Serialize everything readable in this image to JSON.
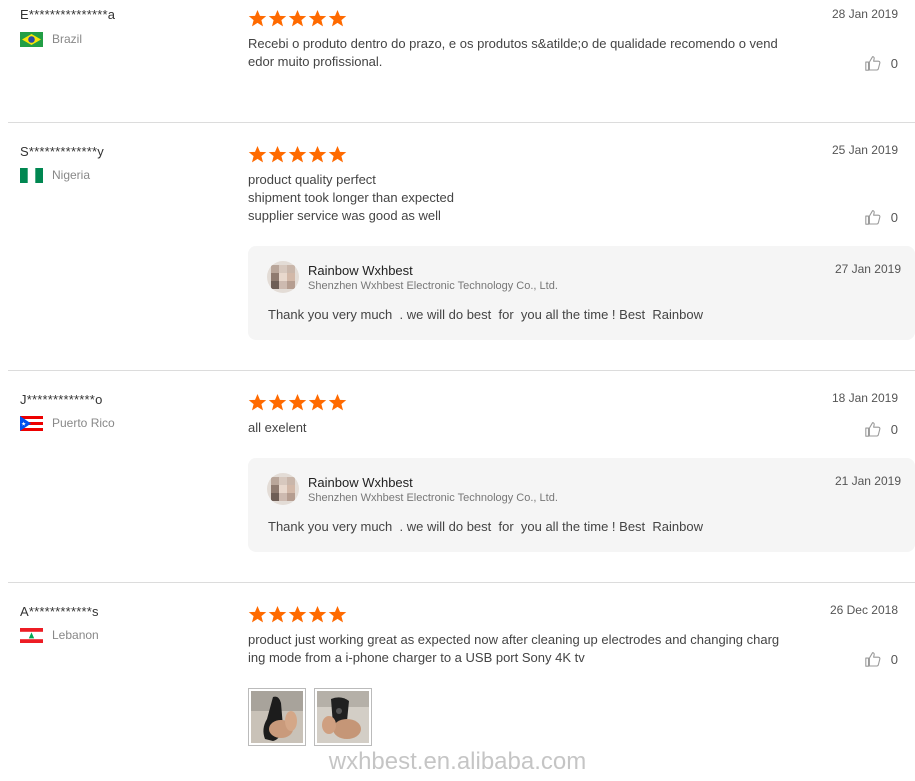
{
  "reviews": [
    {
      "user": "E***************a",
      "country": "Brazil",
      "date": "28 Jan 2019",
      "rating": 5,
      "text": [
        "Recebi o produto dentro do prazo, e os produtos s&atilde;o de qualidade recomendo o vend",
        "edor muito profissional."
      ],
      "likes": "0"
    },
    {
      "user": "S*************y",
      "country": "Nigeria",
      "date": "25 Jan 2019",
      "rating": 5,
      "text": [
        "product quality perfect",
        "shipment took longer than expected",
        "supplier service was good as well"
      ],
      "likes": "0",
      "reply": {
        "name": "Rainbow Wxhbest",
        "company": "Shenzhen Wxhbest Electronic Technology Co., Ltd.",
        "date": "27 Jan 2019",
        "text": "Thank you very much  . we will do best  for  you all the time ! Best  Rainbow"
      }
    },
    {
      "user": "J*************o",
      "country": "Puerto Rico",
      "date": "18 Jan 2019",
      "rating": 5,
      "text": [
        "all exelent"
      ],
      "likes": "0",
      "reply": {
        "name": "Rainbow Wxhbest",
        "company": "Shenzhen Wxhbest Electronic Technology Co., Ltd.",
        "date": "21 Jan 2019",
        "text": "Thank you very much  . we will do best  for  you all the time ! Best  Rainbow"
      }
    },
    {
      "user": "A************s",
      "country": "Lebanon",
      "date": "26 Dec 2018",
      "rating": 5,
      "text": [
        "product just working great as expected now after cleaning up electrodes and changing charg",
        "ing mode from a i-phone charger to a USB port Sony 4K tv"
      ],
      "likes": "0",
      "photos": [
        "review-photo-1",
        "review-photo-2"
      ]
    }
  ],
  "watermark": "wxhbest.en.alibaba.com",
  "colors": {
    "star": "#ff6a00",
    "divider": "#dcdcdc",
    "reply_bg": "#f5f5f5"
  },
  "icons": {
    "rating": "star-icon",
    "like": "thumbs-up-icon"
  }
}
